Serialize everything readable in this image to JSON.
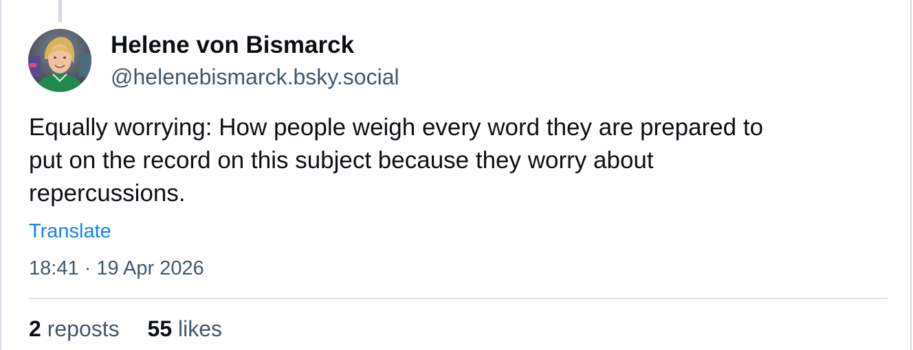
{
  "author": {
    "display_name": "Helene von Bismarck",
    "handle": "@helenebismarck.bsky.social",
    "avatar_icon": "avatar-photo"
  },
  "post": {
    "text_lines": [
      "Equally worrying: How people weigh every word they are prepared to",
      "put on the record on this subject because they worry about",
      "repercussions."
    ],
    "translate_label": "Translate",
    "timestamp": "18:41 · 19 Apr 2026"
  },
  "stats": {
    "reposts_count": "2",
    "reposts_label": "reposts",
    "likes_count": "55",
    "likes_label": "likes"
  },
  "colors": {
    "link": "#1083fe",
    "secondary_text": "#42576c",
    "border": "#d4dbe2"
  }
}
